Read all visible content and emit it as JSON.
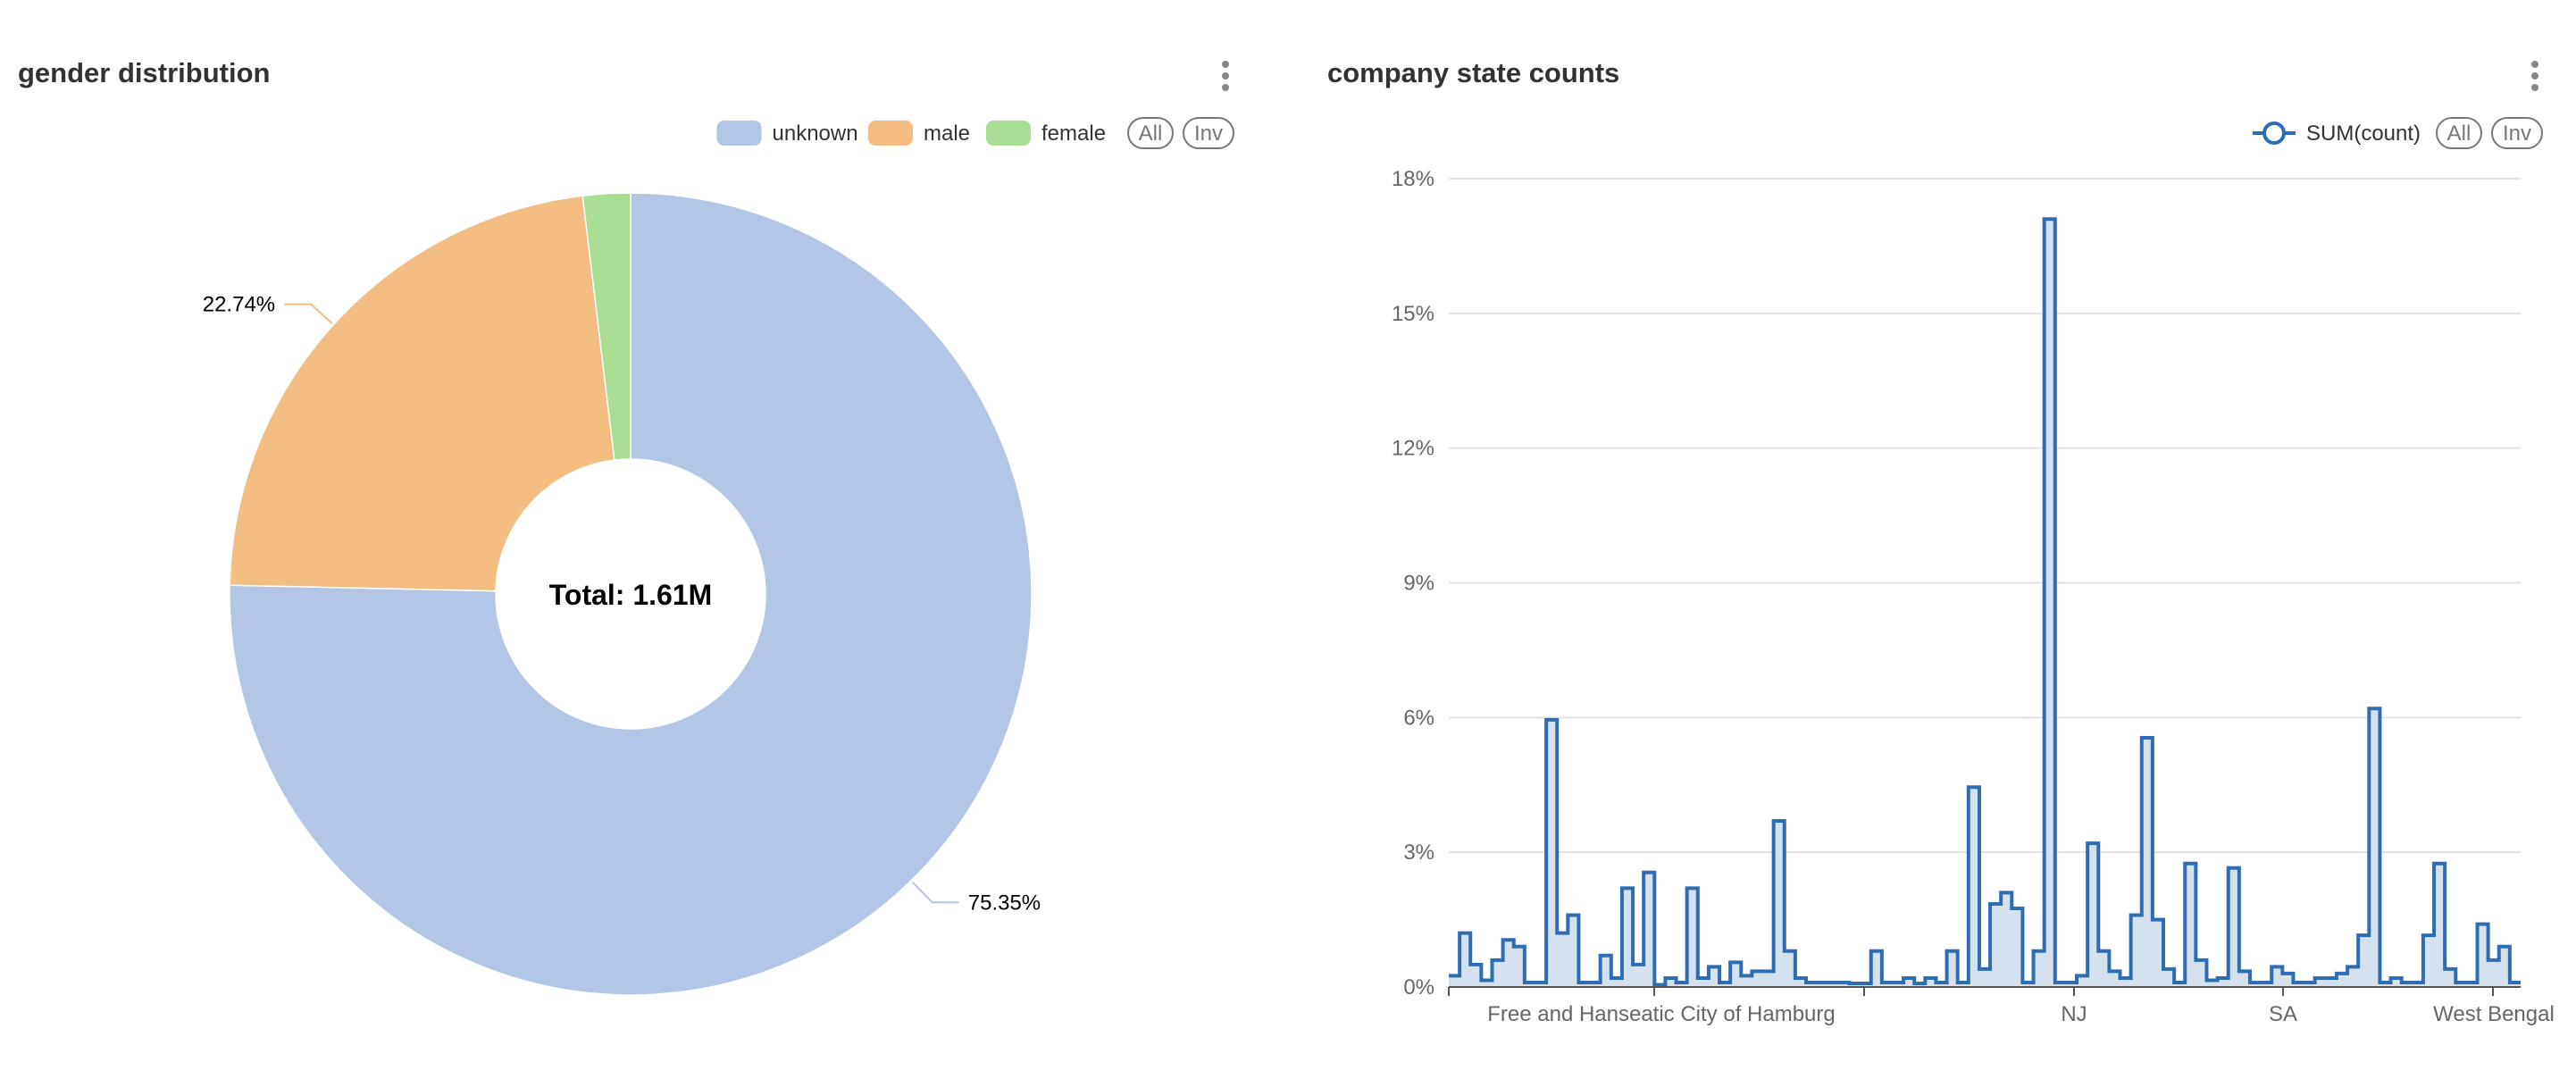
{
  "charts": {
    "left": {
      "title": "gender distribution"
    },
    "right": {
      "title": "company state counts"
    }
  },
  "legend_buttons": {
    "all": "All",
    "inv": "Inv"
  },
  "colors": {
    "unknown": "#b3c6e6",
    "male": "#f4bd82",
    "female": "#a9df94",
    "line": "#2e6db4",
    "area": "#d5e1ef"
  },
  "chart_data": [
    {
      "type": "pie",
      "title": "gender distribution",
      "center_label": "Total: 1.61M",
      "legend": [
        "unknown",
        "male",
        "female"
      ],
      "legend_position": "top-right",
      "slices": [
        {
          "name": "unknown",
          "value": 75.35,
          "label": "75.35%"
        },
        {
          "name": "male",
          "value": 22.74,
          "label": "22.74%"
        },
        {
          "name": "female",
          "value": 1.91
        }
      ]
    },
    {
      "type": "area",
      "title": "company state counts",
      "legend": [
        "SUM(count)"
      ],
      "legend_position": "top-right",
      "series": [
        {
          "name": "SUM(count)",
          "values": [
            0.25,
            1.2,
            0.5,
            0.15,
            0.6,
            1.05,
            0.9,
            0.1,
            0.1,
            5.95,
            1.2,
            1.6,
            0.1,
            0.1,
            0.7,
            0.2,
            2.2,
            0.5,
            2.55,
            0.05,
            0.2,
            0.1,
            2.2,
            0.2,
            0.45,
            0.1,
            0.55,
            0.25,
            0.35,
            0.35,
            3.7,
            0.8,
            0.2,
            0.1,
            0.1,
            0.1,
            0.1,
            0.08,
            0.08,
            0.8,
            0.1,
            0.1,
            0.2,
            0.08,
            0.2,
            0.1,
            0.8,
            0.1,
            4.45,
            0.4,
            1.85,
            2.1,
            1.75,
            0.1,
            0.8,
            17.1,
            0.1,
            0.1,
            0.25,
            3.2,
            0.8,
            0.35,
            0.2,
            1.6,
            5.55,
            1.5,
            0.4,
            0.1,
            2.75,
            0.6,
            0.15,
            0.2,
            2.65,
            0.35,
            0.1,
            0.1,
            0.45,
            0.3,
            0.1,
            0.1,
            0.2,
            0.2,
            0.3,
            0.45,
            1.15,
            6.2,
            0.1,
            0.2,
            0.1,
            0.1,
            1.15,
            2.75,
            0.4,
            0.1,
            0.1,
            1.4,
            0.6,
            0.9,
            0.1
          ]
        }
      ],
      "x_tick_labels": [
        "Free and Hanseatic City of Hamburg",
        "NJ",
        "SA",
        "West Bengal"
      ],
      "ylim": [
        0,
        18
      ],
      "y_ticks": [
        "0%",
        "3%",
        "6%",
        "9%",
        "12%",
        "15%",
        "18%"
      ],
      "grid": true
    }
  ]
}
